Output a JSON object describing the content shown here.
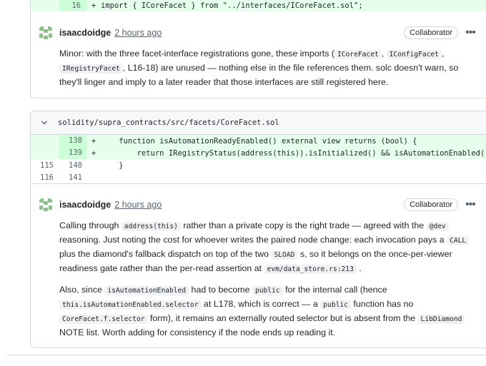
{
  "thread1": {
    "diff_line": {
      "new_num": "16",
      "sign": "+",
      "code": "import { ICoreFacet } from \"../interfaces/ICoreFacet.sol\";"
    },
    "comment": {
      "author": "isaacdoidge",
      "time": "2 hours ago",
      "badge": "Collaborator",
      "more_icon": "kebab-horizontal-icon",
      "body": {
        "t1": "Minor: with the three facet-interface registrations gone, these imports (",
        "c1": "ICoreFacet",
        "t2": ", ",
        "c2": "IConfigFacet",
        "t3": ",",
        "c3": "IRegistryFacet",
        "t4": ", L16-18) are unused — nothing else in the file references them. solc doesn't warn, so they'll linger and imply to a later reader that those interfaces are still registered here."
      }
    }
  },
  "thread2": {
    "file_path": "solidity/supra_contracts/src/facets/CoreFacet.sol",
    "lines": [
      {
        "old": "",
        "new": "138",
        "sign": "+",
        "code": "    function isAutomationReadyEnabled() external view returns (bool) {",
        "type": "add"
      },
      {
        "old": "",
        "new": "139",
        "sign": "+",
        "code": "        return IRegistryStatus(address(this)).isInitialized() && isAutomationEnabled();",
        "type": "add"
      },
      {
        "old": "115",
        "new": "140",
        "sign": "",
        "code": "    }",
        "type": "ctx"
      },
      {
        "old": "116",
        "new": "141",
        "sign": "",
        "code": "",
        "type": "ctx"
      }
    ],
    "comment": {
      "author": "isaacdoidge",
      "time": "2 hours ago",
      "badge": "Collaborator",
      "more_icon": "kebab-horizontal-icon",
      "p1": {
        "t1": "Calling through ",
        "c1": "address(this)",
        "t2": " rather than a private copy is the right trade — agreed with the ",
        "c2": "@dev",
        "t3": " reasoning. Just noting the cost for whoever writes the paired node change: each invocation pays a ",
        "c3": "CALL",
        "t4": " plus the diamond's fallback dispatch on top of the two ",
        "c4": "SLOAD",
        "t5": " s, so it belongs on the once-per-viewer readiness gate rather than the per-read assertion at ",
        "c5": "evm/data_store.rs:213",
        "t6": " ."
      },
      "p2": {
        "t1": "Also, since ",
        "c1": "isAutomationEnabled",
        "t2": " had to become ",
        "c2": "public",
        "t3": " for the internal call (hence ",
        "c3": "this.isAutomationEnabled.selector",
        "t4": " at L178, which is correct — a ",
        "c4": "public",
        "t5": " function has no ",
        "c5": "CoreFacet.f.selector",
        "t6": " form), it remains an externally routed selector but is absent from the ",
        "c6": "LibDiamond",
        "t7": " NOTE list. Worth adding for consistency if the node ends up reading it."
      }
    }
  },
  "colors": {
    "add_bg": "#e6ffec",
    "add_num_bg": "#ccffd8",
    "border": "#d0d7de",
    "avatar_green": "#8fbf8a"
  }
}
